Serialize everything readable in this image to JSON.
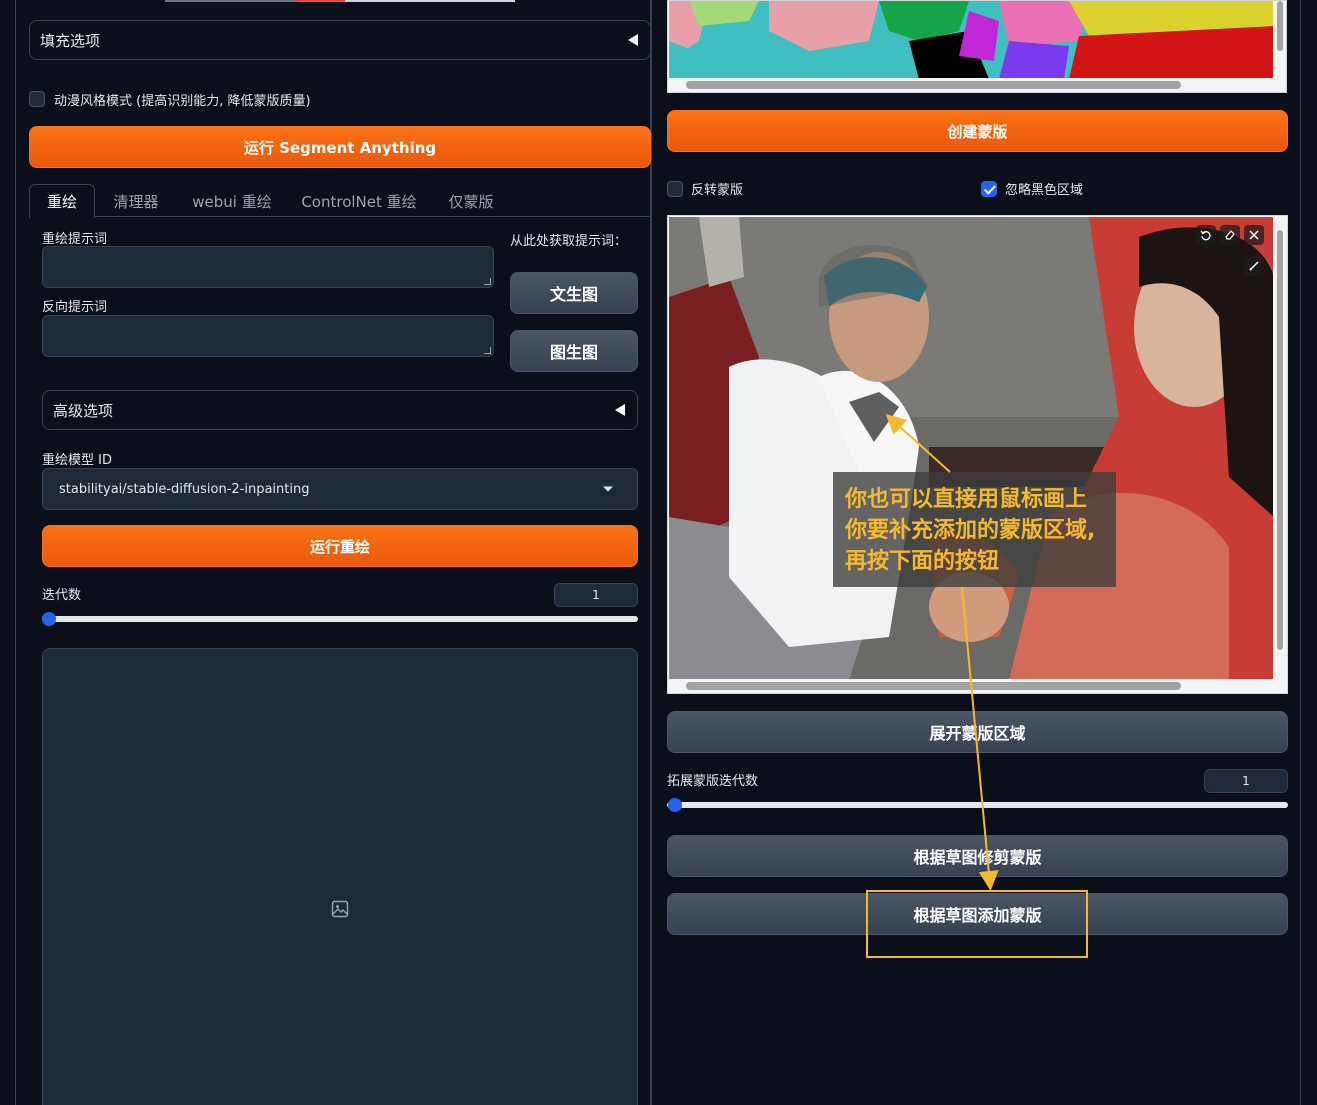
{
  "left": {
    "fill_options": "填充选项",
    "anime_mode_label": "动漫风格模式 (提高识别能力, 降低蒙版质量)",
    "run_sam_button": "运行 Segment Anything",
    "tabs": [
      {
        "label": "重绘",
        "active": true
      },
      {
        "label": "清理器",
        "active": false
      },
      {
        "label": "webui 重绘",
        "active": false
      },
      {
        "label": "ControlNet 重绘",
        "active": false
      },
      {
        "label": "仅蒙版",
        "active": false
      }
    ],
    "inpaint_prompt_label": "重绘提示词",
    "negative_prompt_label": "反向提示词",
    "get_prompt_label": "从此处获取提示词：",
    "txt2img_button": "文生图",
    "img2img_button": "图生图",
    "advanced_options": "高级选项",
    "model_id_label": "重绘模型 ID",
    "model_id_value": "stabilityai/stable-diffusion-2-inpainting",
    "run_inpaint_button": "运行重绘",
    "iterations_label": "迭代数",
    "iterations_value": "1",
    "iterations_fraction": 0.0
  },
  "right": {
    "create_mask_button": "创建蒙版",
    "invert_mask_label": "反转蒙版",
    "invert_mask_checked": false,
    "ignore_black_label": "忽略黑色区域",
    "ignore_black_checked": true,
    "expand_mask_button": "展开蒙版区域",
    "expand_iterations_label": "拓展蒙版迭代数",
    "expand_iterations_value": "1",
    "expand_iterations_fraction": 0.0,
    "trim_mask_button": "根据草图修剪蒙版",
    "add_mask_button": "根据草图添加蒙版",
    "image_tools": [
      "undo-icon",
      "eraser-icon",
      "close-icon",
      "brush-icon"
    ]
  },
  "annotation": {
    "lines": [
      "你也可以直接用鼠标画上",
      "你要补充添加的蒙版区域,",
      "再按下面的按钮"
    ]
  },
  "colors": {
    "accent_orange": "#f97316",
    "annotation_yellow": "#f5b82e",
    "check_blue": "#2563eb",
    "background": "#0b0f19"
  }
}
